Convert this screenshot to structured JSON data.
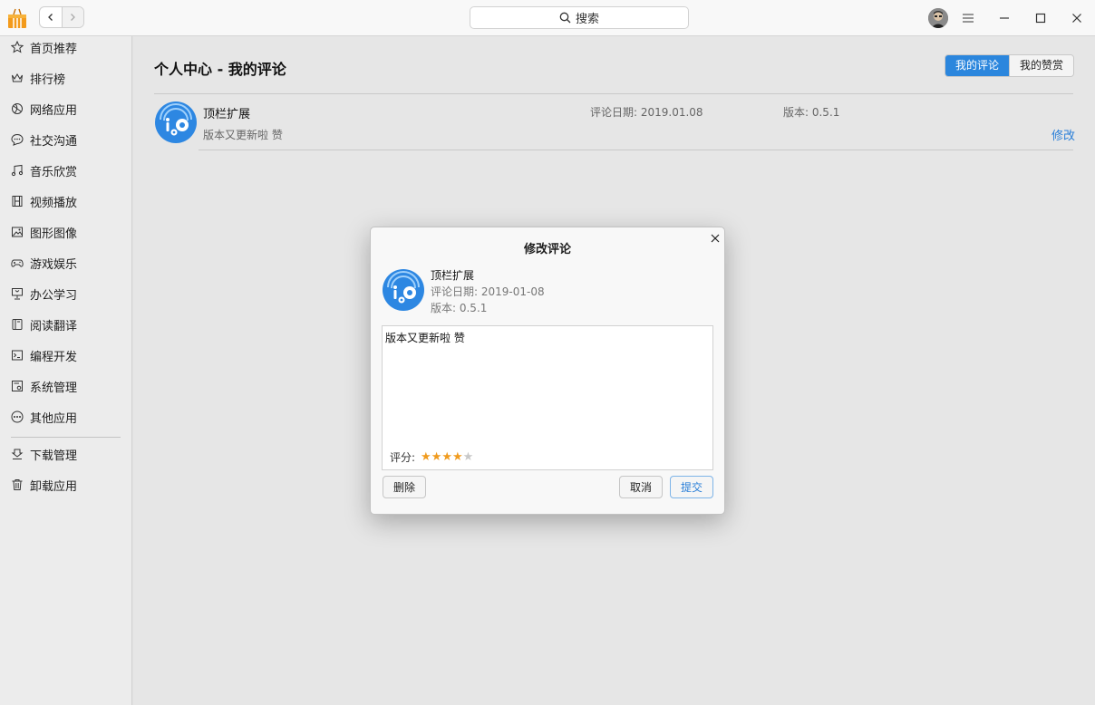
{
  "titlebar": {
    "search_label": "搜索",
    "icons": [
      "app-store-logo-icon",
      "back-arrow-icon",
      "forward-arrow-icon",
      "search-icon",
      "avatar",
      "menu-icon",
      "minimize-icon",
      "maximize-icon",
      "close-icon"
    ]
  },
  "sidebar": {
    "items": [
      {
        "label": "首页推荐",
        "icon": "star-icon"
      },
      {
        "label": "排行榜",
        "icon": "crown-icon"
      },
      {
        "label": "网络应用",
        "icon": "globe-icon"
      },
      {
        "label": "社交沟通",
        "icon": "chat-icon"
      },
      {
        "label": "音乐欣赏",
        "icon": "music-note-icon"
      },
      {
        "label": "视频播放",
        "icon": "film-icon"
      },
      {
        "label": "图形图像",
        "icon": "image-icon"
      },
      {
        "label": "游戏娱乐",
        "icon": "gamepad-icon"
      },
      {
        "label": "办公学习",
        "icon": "presentation-icon"
      },
      {
        "label": "阅读翻译",
        "icon": "book-icon"
      },
      {
        "label": "编程开发",
        "icon": "terminal-icon"
      },
      {
        "label": "系统管理",
        "icon": "settings-panel-icon"
      },
      {
        "label": "其他应用",
        "icon": "more-dots-icon"
      },
      {
        "label": "下载管理",
        "icon": "download-icon"
      },
      {
        "label": "卸载应用",
        "icon": "trash-icon"
      }
    ]
  },
  "main": {
    "title": "个人中心 - 我的评论",
    "tabs": [
      {
        "label": "我的评论",
        "active": true
      },
      {
        "label": "我的赞赏",
        "active": false
      }
    ],
    "reviews": [
      {
        "app_name": "顶栏扩展",
        "date": "评论日期:  2019.01.08",
        "version": "版本:  0.5.1",
        "text": "版本又更新啦 赞",
        "edit_label": "修改"
      }
    ]
  },
  "dialog": {
    "title": "修改评论",
    "app_name": "顶栏扩展",
    "date": "评论日期:  2019-01-08",
    "version": "版本:  0.5.1",
    "comment": "版本又更新啦 赞",
    "rating_label": "评分:",
    "rating": 4,
    "rating_max": 5,
    "delete_label": "删除",
    "cancel_label": "取消",
    "submit_label": "提交"
  },
  "colors": {
    "accent": "#2b86dd",
    "star_on": "#f09b1e",
    "star_off": "#c8c8c8",
    "app_icon": "#2d87e2"
  }
}
